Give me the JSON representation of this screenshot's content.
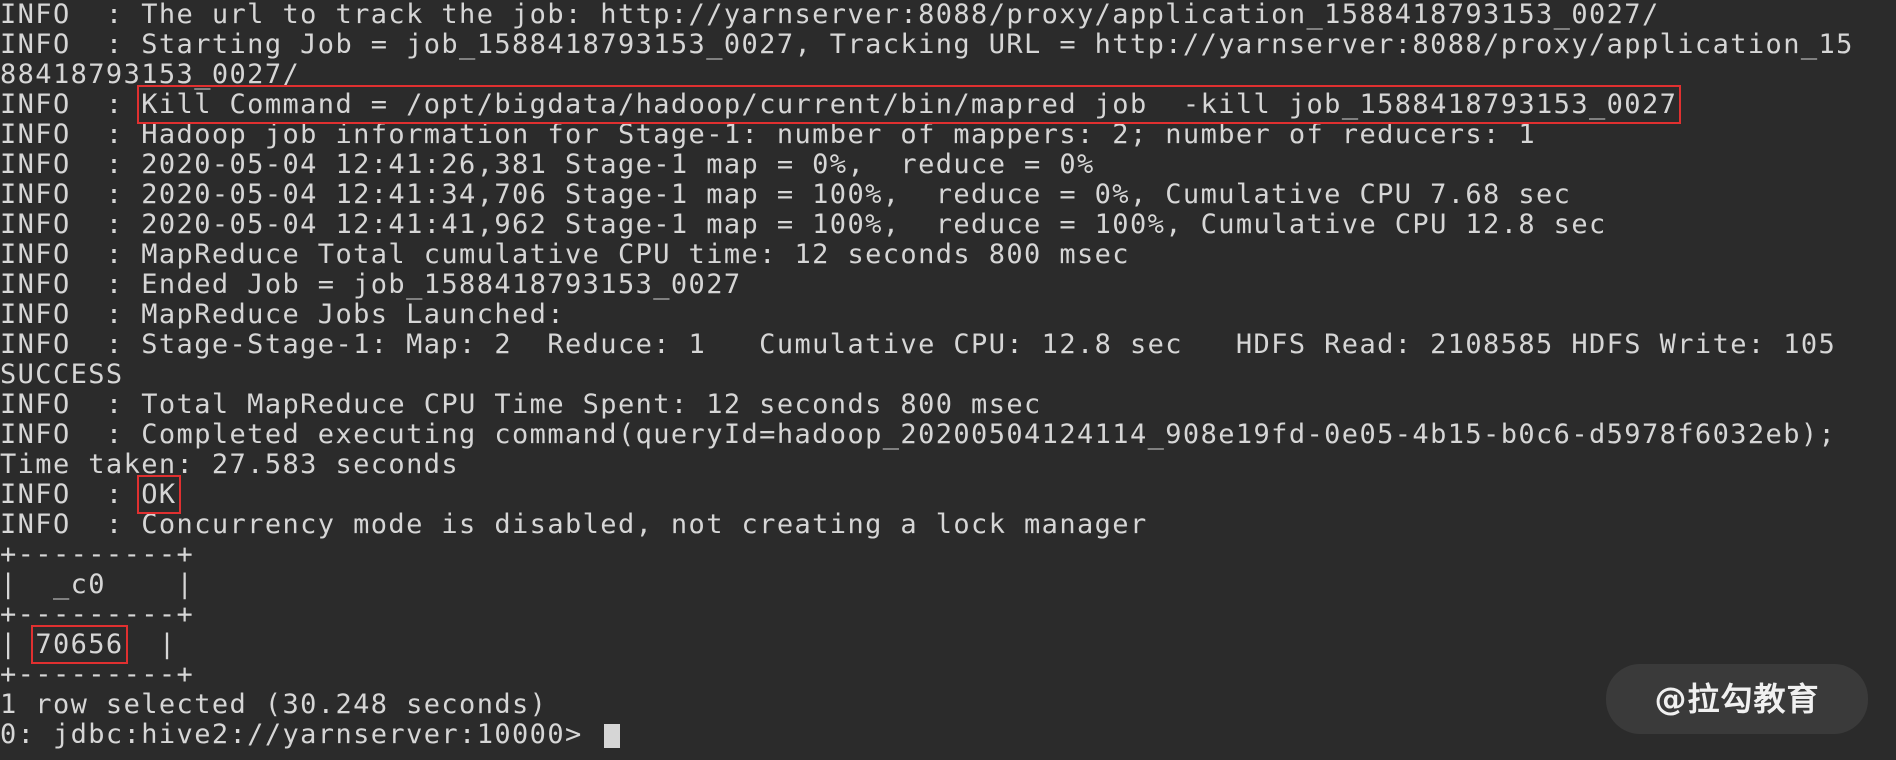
{
  "terminal": {
    "lines": [
      "INFO  : The url to track the job: http://yarnserver:8088/proxy/application_1588418793153_0027/",
      "INFO  : Starting Job = job_1588418793153_0027, Tracking URL = http://yarnserver:8088/proxy/application_15",
      "88418793153_0027/",
      "INFO  : ",
      "INFO  : Hadoop job information for Stage-1: number of mappers: 2; number of reducers: 1",
      "INFO  : 2020-05-04 12:41:26,381 Stage-1 map = 0%,  reduce = 0%",
      "INFO  : 2020-05-04 12:41:34,706 Stage-1 map = 100%,  reduce = 0%, Cumulative CPU 7.68 sec",
      "INFO  : 2020-05-04 12:41:41,962 Stage-1 map = 100%,  reduce = 100%, Cumulative CPU 12.8 sec",
      "INFO  : MapReduce Total cumulative CPU time: 12 seconds 800 msec",
      "INFO  : Ended Job = job_1588418793153_0027",
      "INFO  : MapReduce Jobs Launched:",
      "INFO  : Stage-Stage-1: Map: 2  Reduce: 1   Cumulative CPU: 12.8 sec   HDFS Read: 2108585 HDFS Write: 105",
      "SUCCESS",
      "INFO  : Total MapReduce CPU Time Spent: 12 seconds 800 msec",
      "INFO  : Completed executing command(queryId=hadoop_20200504124114_908e19fd-0e05-4b15-b0c6-d5978f6032eb);",
      "Time taken: 27.583 seconds",
      "INFO  : ",
      "INFO  : Concurrency mode is disabled, not creating a lock manager",
      "+---------+",
      "|  _c0    |",
      "+---------+",
      "| ",
      "+---------+",
      "1 row selected (30.248 seconds)",
      "0: jdbc:hive2://yarnserver:10000> "
    ],
    "kill_command": "Kill Command = /opt/bigdata/hadoop/current/bin/mapred job  -kill job_1588418793153_0027",
    "ok_text": "OK",
    "result_value": "70656",
    "result_suffix": "  |"
  },
  "watermark": {
    "text": "@拉勾教育"
  },
  "colors": {
    "background": "#2b2b2b",
    "text": "#d6d6d6",
    "highlight": "#e03030"
  }
}
